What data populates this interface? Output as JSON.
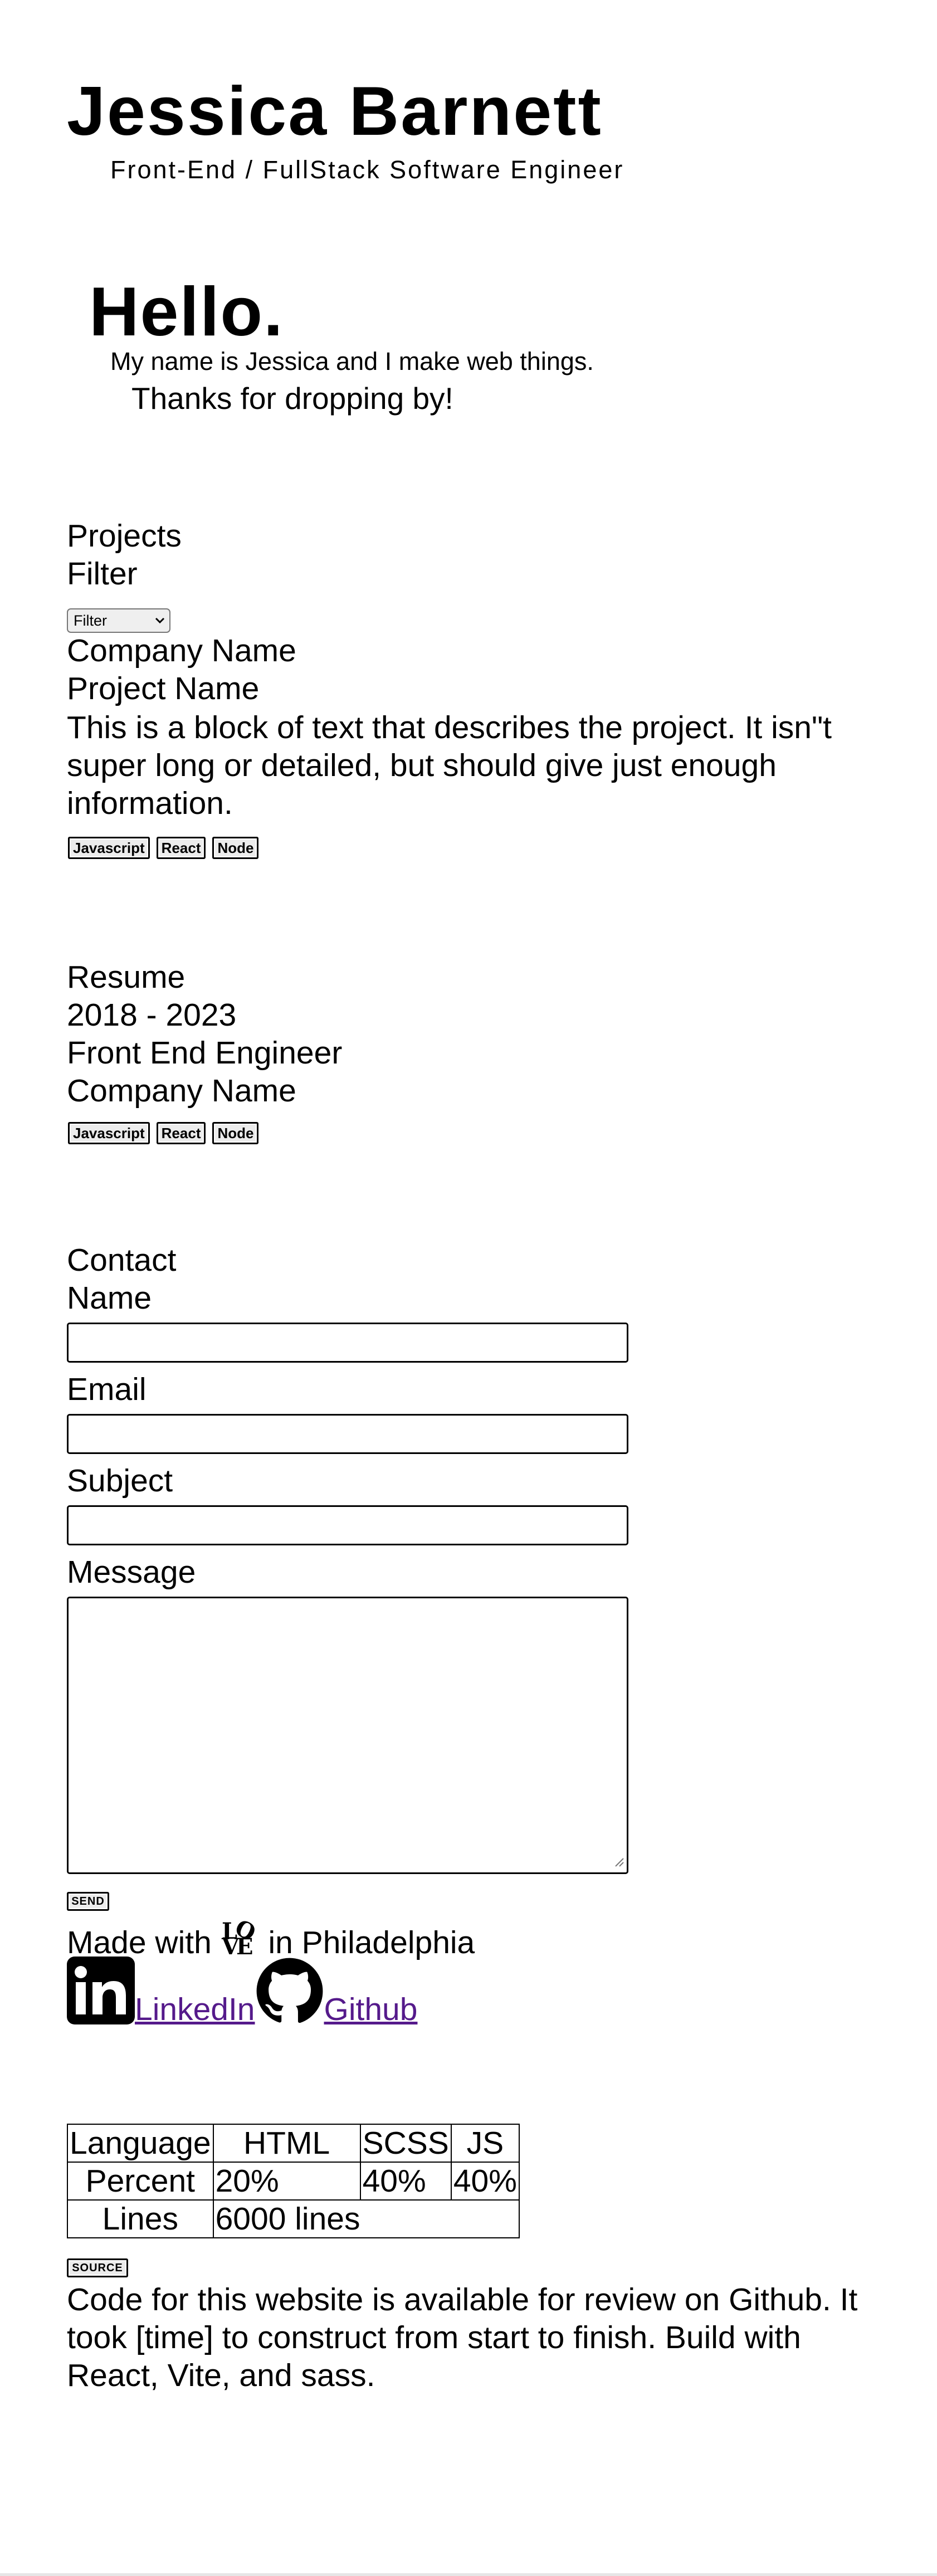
{
  "header": {
    "name": "Jessica Barnett",
    "subtitle": "Front-End / FullStack Software Engineer"
  },
  "hello": {
    "heading": "Hello.",
    "intro": "My name is Jessica and I make web things.",
    "thanks": "Thanks for dropping by!"
  },
  "projects": {
    "heading": "Projects",
    "filter_label": "Filter",
    "filter_selected": "Filter",
    "items": [
      {
        "company": "Company Name",
        "name": "Project Name",
        "description": "This is a block of text that describes the project. It isn\"t super long or detailed, but should give just enough information.",
        "tags": [
          "Javascript",
          "React",
          "Node"
        ]
      }
    ]
  },
  "resume": {
    "heading": "Resume",
    "items": [
      {
        "dates": "2018 - 2023",
        "title": "Front End Engineer",
        "company": "Company Name",
        "tags": [
          "Javascript",
          "React",
          "Node"
        ]
      }
    ]
  },
  "contact": {
    "heading": "Contact",
    "name_label": "Name",
    "email_label": "Email",
    "subject_label": "Subject",
    "message_label": "Message",
    "send_label": "SEND"
  },
  "footer": {
    "made_with_prefix": "Made with",
    "love_logo": "LOVE",
    "made_with_suffix": "in Philadelphia",
    "linkedin_label": "LinkedIn",
    "github_label": "Github",
    "source_label": "SOURCE",
    "source_description": "Code for this website is available for review on Github. It took [time] to construct from start to finish. Build with React, Vite, and sass."
  },
  "stats": {
    "language_header": "Language",
    "percent_header": "Percent",
    "lines_header": "Lines",
    "languages": [
      "HTML",
      "SCSS",
      "JS"
    ],
    "percents": [
      "20%",
      "40%",
      "40%"
    ],
    "lines": "6000 lines"
  }
}
